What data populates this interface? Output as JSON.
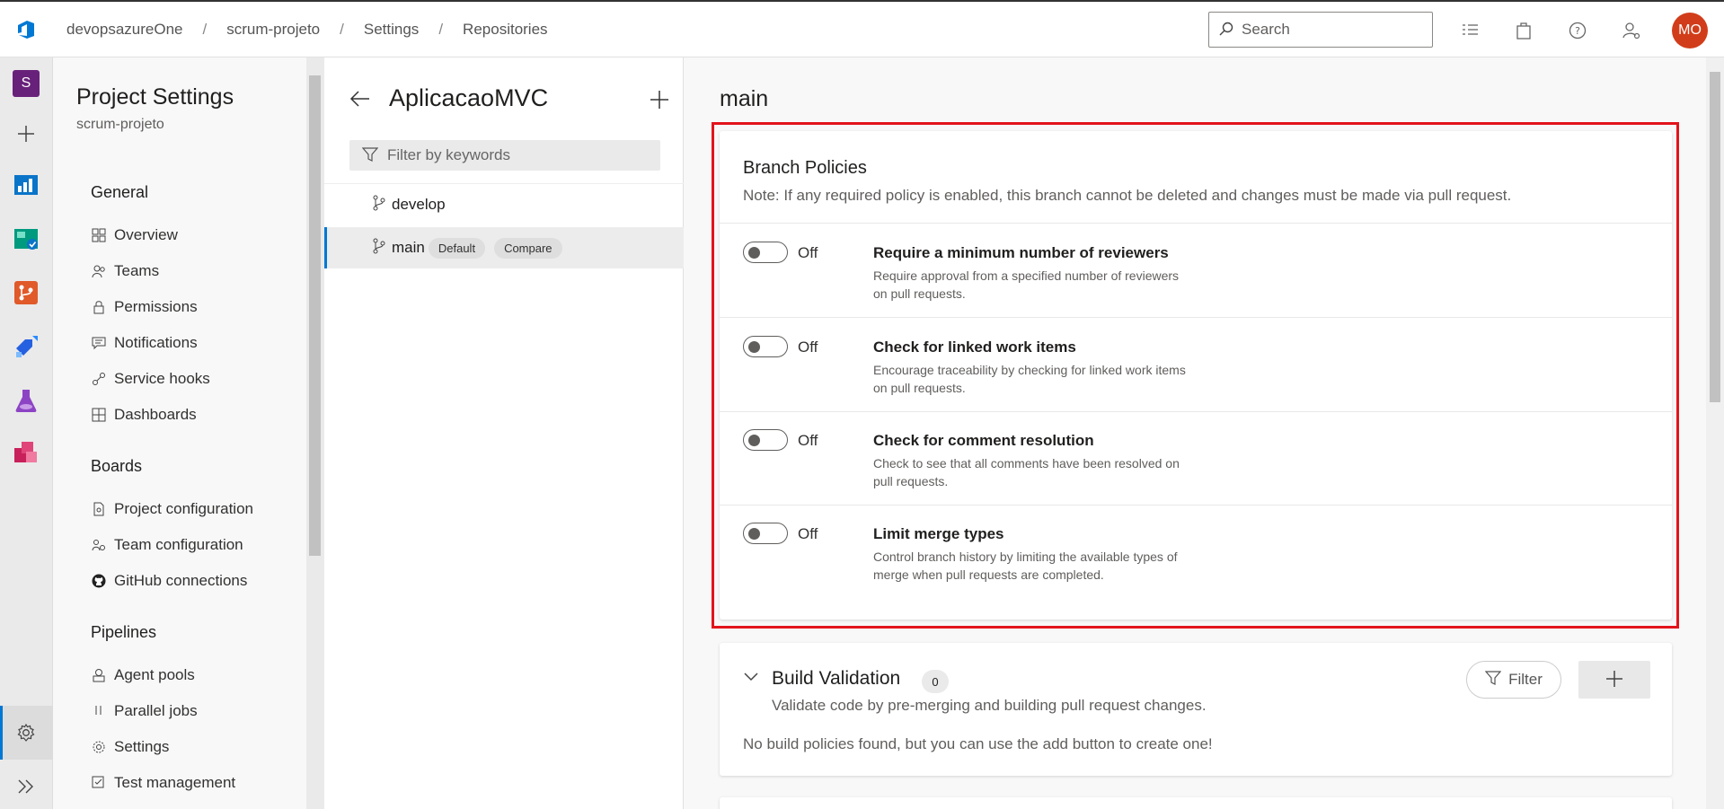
{
  "topbar": {
    "breadcrumbs": [
      "devopsazureOne",
      "scrum-projeto",
      "Settings",
      "Repositories"
    ],
    "search_placeholder": "Search",
    "avatar_initials": "MO",
    "avatar_color": "#d13d1a"
  },
  "rail": {
    "project_initial": "S",
    "project_color": "#68217a"
  },
  "project_settings": {
    "title": "Project Settings",
    "project": "scrum-projeto",
    "sections": [
      {
        "name": "General",
        "items": [
          "Overview",
          "Teams",
          "Permissions",
          "Notifications",
          "Service hooks",
          "Dashboards"
        ]
      },
      {
        "name": "Boards",
        "items": [
          "Project configuration",
          "Team configuration",
          "GitHub connections"
        ]
      },
      {
        "name": "Pipelines",
        "items": [
          "Agent pools",
          "Parallel jobs",
          "Settings",
          "Test management"
        ]
      }
    ]
  },
  "repo": {
    "name": "AplicacaoMVC",
    "filter_placeholder": "Filter by keywords",
    "branches": [
      {
        "name": "develop",
        "badges": []
      },
      {
        "name": "main",
        "badges": [
          "Default",
          "Compare"
        ]
      }
    ]
  },
  "main": {
    "branch_title": "main",
    "branch_policies": {
      "title": "Branch Policies",
      "note": "Note: If any required policy is enabled, this branch cannot be deleted and changes must be made via pull request.",
      "policies": [
        {
          "state": "Off",
          "title": "Require a minimum number of reviewers",
          "desc1": "Require approval from a specified number of reviewers",
          "desc2": "on pull requests."
        },
        {
          "state": "Off",
          "title": "Check for linked work items",
          "desc1": "Encourage traceability by checking for linked work items",
          "desc2": "on pull requests."
        },
        {
          "state": "Off",
          "title": "Check for comment resolution",
          "desc1": "Check to see that all comments have been resolved on",
          "desc2": "pull requests."
        },
        {
          "state": "Off",
          "title": "Limit merge types",
          "desc1": "Control branch history by limiting the available types of",
          "desc2": "merge when pull requests are completed."
        }
      ]
    },
    "build_validation": {
      "title": "Build Validation",
      "count": "0",
      "desc": "Validate code by pre-merging and building pull request changes.",
      "empty": "No build policies found, but you can use the add button to create one!",
      "filter_label": "Filter"
    }
  },
  "accent_color": "#0078d4",
  "highlight_color": "#e3131b"
}
